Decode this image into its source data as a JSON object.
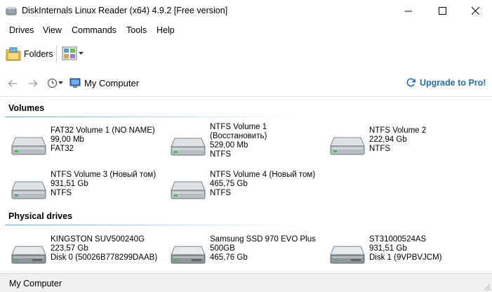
{
  "window": {
    "title": "DiskInternals Linux Reader (x64) 4.9.2 [Free version]",
    "minimize_icon": "minimize-icon",
    "maximize_icon": "maximize-icon",
    "close_icon": "close-icon"
  },
  "menu": {
    "items": [
      "Drives",
      "View",
      "Commands",
      "Tools",
      "Help"
    ]
  },
  "toolbar": {
    "folders_label": "Folders",
    "view_icon": "view-mode-icon"
  },
  "nav": {
    "location": "My Computer",
    "upgrade_label": "Upgrade to Pro!"
  },
  "sections": {
    "volumes_title": "Volumes",
    "physical_title": "Physical drives"
  },
  "volumes": [
    {
      "lines": [
        "FAT32 Volume 1 (NO NAME)",
        "99,00 Mb",
        "FAT32"
      ]
    },
    {
      "lines": [
        "NTFS Volume 1",
        "(Восстановить)",
        "529,00 Mb",
        "NTFS"
      ]
    },
    {
      "lines": [
        "NTFS Volume 2",
        "222,94 Gb",
        "NTFS"
      ]
    },
    {
      "lines": [
        "NTFS Volume 3 (Новый том)",
        "931,51 Gb",
        "NTFS"
      ]
    },
    {
      "lines": [
        "NTFS Volume 4 (Новый том)",
        "465,75 Gb",
        "NTFS"
      ]
    }
  ],
  "physical_drives": [
    {
      "lines": [
        "KINGSTON SUV500240G",
        "223,57 Gb",
        "Disk 0 (50026B778299DAAB)"
      ]
    },
    {
      "lines": [
        "Samsung SSD 970 EVO Plus",
        "500GB",
        "465,76 Gb"
      ]
    },
    {
      "lines": [
        "ST31000524AS",
        "931,51 Gb",
        "Disk 1 (9VPBVJCM)"
      ]
    }
  ],
  "status": {
    "text": "My Computer"
  },
  "colors": {
    "accent": "#1f6fb5",
    "section_line": "#6aa7d8",
    "drive_led": "#3cc43c"
  }
}
